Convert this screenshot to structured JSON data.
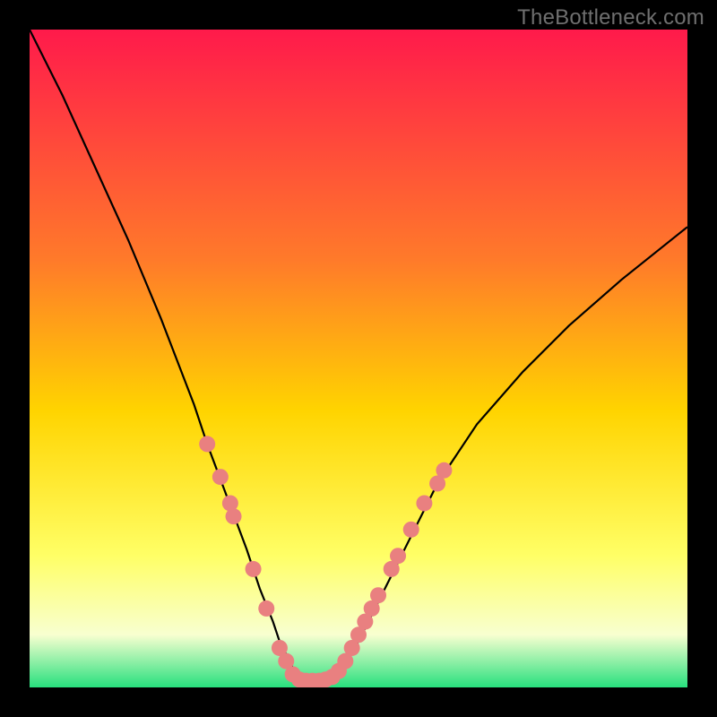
{
  "watermark": "TheBottleneck.com",
  "colors": {
    "black": "#000000",
    "gradient_top": "#ff1a4b",
    "gradient_mid_upper": "#ff7a2a",
    "gradient_mid": "#ffd400",
    "gradient_mid_lower": "#ffff66",
    "gradient_pale": "#f8ffd0",
    "gradient_green": "#28e07e",
    "curve": "#000000",
    "marker": "#e98080"
  },
  "chart_data": {
    "type": "line",
    "title": "",
    "xlabel": "",
    "ylabel": "",
    "xlim": [
      0,
      100
    ],
    "ylim": [
      0,
      100
    ],
    "series": [
      {
        "name": "bottleneck-curve",
        "x": [
          0,
          5,
          10,
          15,
          20,
          25,
          27,
          30,
          33,
          35,
          37,
          38,
          39,
          40,
          41,
          42,
          43,
          44,
          45,
          46,
          48,
          50,
          52,
          55,
          58,
          62,
          68,
          75,
          82,
          90,
          100
        ],
        "y": [
          100,
          90,
          79,
          68,
          56,
          43,
          37,
          29,
          21,
          15,
          10,
          7,
          5,
          3,
          1.5,
          1,
          1,
          1,
          1.5,
          2,
          4,
          7,
          11,
          17,
          23,
          31,
          40,
          48,
          55,
          62,
          70
        ]
      }
    ],
    "markers": {
      "name": "highlighted-points",
      "points": [
        {
          "x": 27,
          "y": 37
        },
        {
          "x": 29,
          "y": 32
        },
        {
          "x": 30.5,
          "y": 28
        },
        {
          "x": 31,
          "y": 26
        },
        {
          "x": 34,
          "y": 18
        },
        {
          "x": 36,
          "y": 12
        },
        {
          "x": 38,
          "y": 6
        },
        {
          "x": 39,
          "y": 4
        },
        {
          "x": 40,
          "y": 2
        },
        {
          "x": 41,
          "y": 1.2
        },
        {
          "x": 42,
          "y": 1
        },
        {
          "x": 43,
          "y": 1
        },
        {
          "x": 44,
          "y": 1
        },
        {
          "x": 45,
          "y": 1.2
        },
        {
          "x": 46,
          "y": 1.6
        },
        {
          "x": 47,
          "y": 2.5
        },
        {
          "x": 48,
          "y": 4
        },
        {
          "x": 49,
          "y": 6
        },
        {
          "x": 50,
          "y": 8
        },
        {
          "x": 51,
          "y": 10
        },
        {
          "x": 52,
          "y": 12
        },
        {
          "x": 53,
          "y": 14
        },
        {
          "x": 55,
          "y": 18
        },
        {
          "x": 56,
          "y": 20
        },
        {
          "x": 58,
          "y": 24
        },
        {
          "x": 60,
          "y": 28
        },
        {
          "x": 62,
          "y": 31
        },
        {
          "x": 63,
          "y": 33
        }
      ]
    }
  }
}
